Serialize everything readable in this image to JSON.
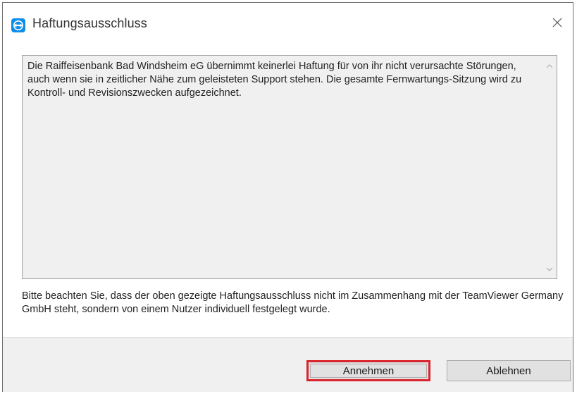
{
  "window": {
    "title": "Haftungsausschluss",
    "app_icon": "teamviewer-icon",
    "close_icon": "close-icon"
  },
  "disclaimer": {
    "text": "Die Raiffeisenbank Bad Windsheim eG übernimmt keinerlei Haftung für von ihr nicht verursachte Störungen, auch wenn sie in zeitlicher Nähe zum geleisteten Support stehen. Die gesamte Fernwartungs-Sitzung wird zu Kontroll- und Revisionszwecken aufgezeichnet."
  },
  "notice": {
    "text": "Bitte beachten Sie, dass der oben gezeigte Haftungsausschluss nicht im Zusammenhang mit der TeamViewer Germany GmbH steht, sondern von einem Nutzer individuell festgelegt wurde."
  },
  "buttons": {
    "accept_label": "Annehmen",
    "decline_label": "Ablehnen"
  },
  "colors": {
    "highlight": "#d9252f",
    "icon_blue": "#0e8ee9"
  }
}
